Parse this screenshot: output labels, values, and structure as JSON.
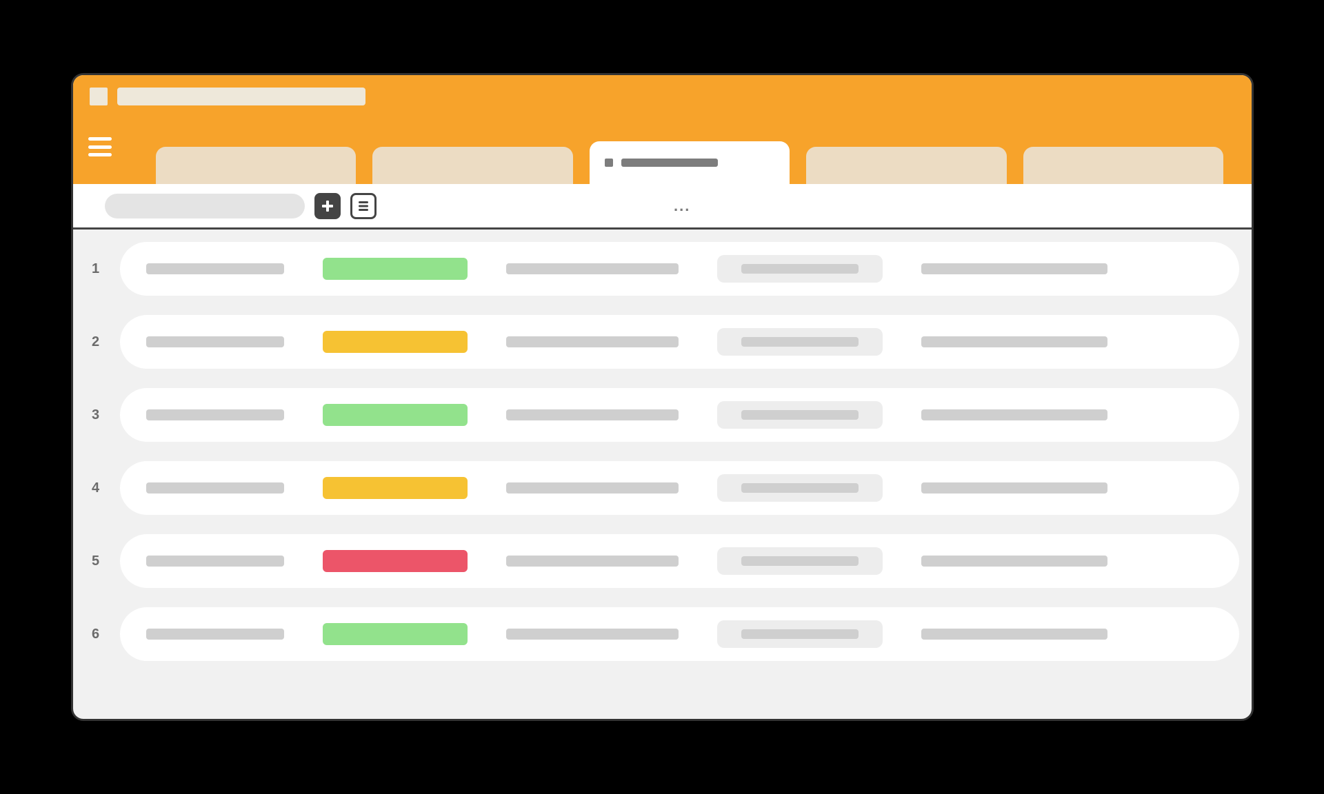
{
  "header": {
    "title": "",
    "tabs": [
      {
        "label": "",
        "active": false
      },
      {
        "label": "",
        "active": false
      },
      {
        "label": "",
        "active": true
      },
      {
        "label": "",
        "active": false
      },
      {
        "label": "",
        "active": false
      }
    ]
  },
  "toolbar": {
    "search_value": "",
    "search_placeholder": "",
    "more_label": "..."
  },
  "status_colors": {
    "green": "#92e28c",
    "yellow": "#f6c233",
    "red": "#ec5569"
  },
  "rows": [
    {
      "num": "1",
      "col1": "",
      "status": "green",
      "col3": "",
      "col4": "",
      "col5": ""
    },
    {
      "num": "2",
      "col1": "",
      "status": "yellow",
      "col3": "",
      "col4": "",
      "col5": ""
    },
    {
      "num": "3",
      "col1": "",
      "status": "green",
      "col3": "",
      "col4": "",
      "col5": ""
    },
    {
      "num": "4",
      "col1": "",
      "status": "yellow",
      "col3": "",
      "col4": "",
      "col5": ""
    },
    {
      "num": "5",
      "col1": "",
      "status": "red",
      "col3": "",
      "col4": "",
      "col5": ""
    },
    {
      "num": "6",
      "col1": "",
      "status": "green",
      "col3": "",
      "col4": "",
      "col5": ""
    }
  ]
}
